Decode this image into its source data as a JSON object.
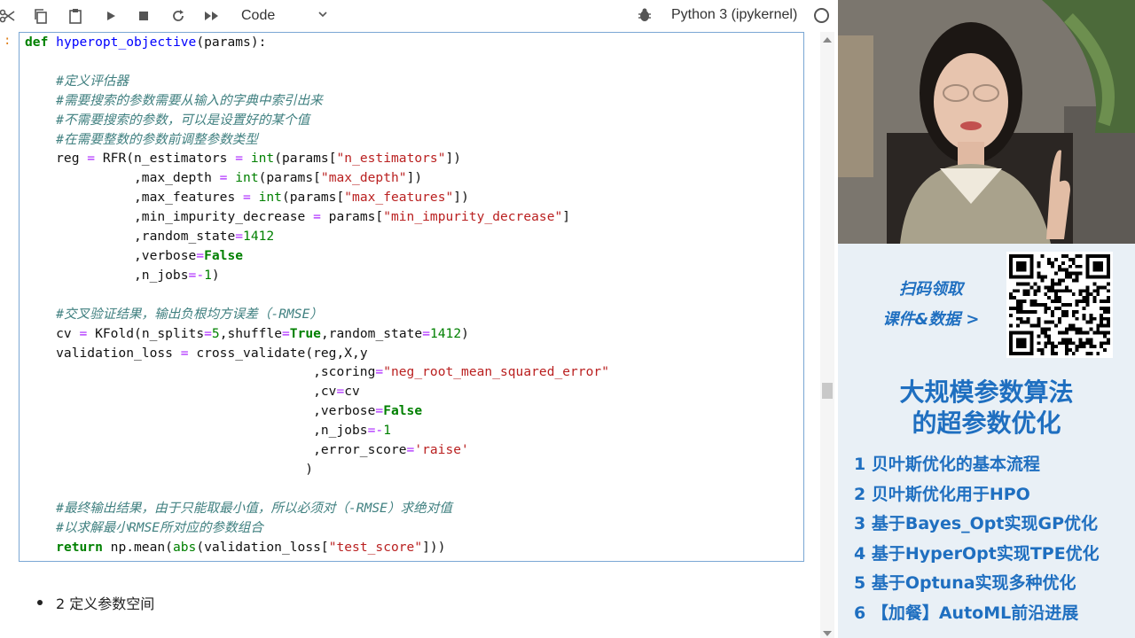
{
  "toolbar": {
    "cell_type": "Code",
    "kernel_name": "Python 3 (ipykernel)"
  },
  "cell": {
    "prompt": ":",
    "code_lines": [
      "def hyperopt_objective(params):",
      "",
      "    #定义评估器",
      "    #需要搜索的参数需要从输入的字典中索引出来",
      "    #不需要搜索的参数，可以是设置好的某个值",
      "    #在需要整数的参数前调整参数类型",
      "    reg = RFR(n_estimators = int(params[\"n_estimators\"])",
      "              ,max_depth = int(params[\"max_depth\"])",
      "              ,max_features = int(params[\"max_features\"])",
      "              ,min_impurity_decrease = params[\"min_impurity_decrease\"]",
      "              ,random_state=1412",
      "              ,verbose=False",
      "              ,n_jobs=-1)",
      "",
      "    #交叉验证结果，输出负根均方误差（-RMSE）",
      "    cv = KFold(n_splits=5,shuffle=True,random_state=1412)",
      "    validation_loss = cross_validate(reg,X,y",
      "                                     ,scoring=\"neg_root_mean_squared_error\"",
      "                                     ,cv=cv",
      "                                     ,verbose=False",
      "                                     ,n_jobs=-1",
      "                                     ,error_score='raise'",
      "                                    )",
      "",
      "    #最终输出结果，由于只能取最小值，所以必须对（-RMSE）求绝对值",
      "    #以求解最小RMSE所对应的参数组合",
      "    return np.mean(abs(validation_loss[\"test_score\"]))"
    ]
  },
  "markdown": {
    "bullet_text": "2 定义参数空间"
  },
  "promo": {
    "line1": "扫码领取",
    "line2": "课件&数据 >",
    "course_title_line1": "大规模参数算法",
    "course_title_line2": "的超参数优化",
    "lessons": [
      "1 贝叶斯优化的基本流程",
      "2 贝叶斯优化用于HPO",
      "3 基于Bayes_Opt实现GP优化",
      "4 基于HyperOpt实现TPE优化",
      "5 基于Optuna实现多种优化",
      "6 【加餐】AutoML前沿进展"
    ]
  },
  "colors": {
    "accent_blue": "#1f6fc0",
    "panel_bg": "#e9f0f6",
    "cell_border": "#7aa7d4",
    "keyword": "#008000",
    "string": "#ba2121",
    "comment": "#408080",
    "prompt": "#e0801a"
  }
}
